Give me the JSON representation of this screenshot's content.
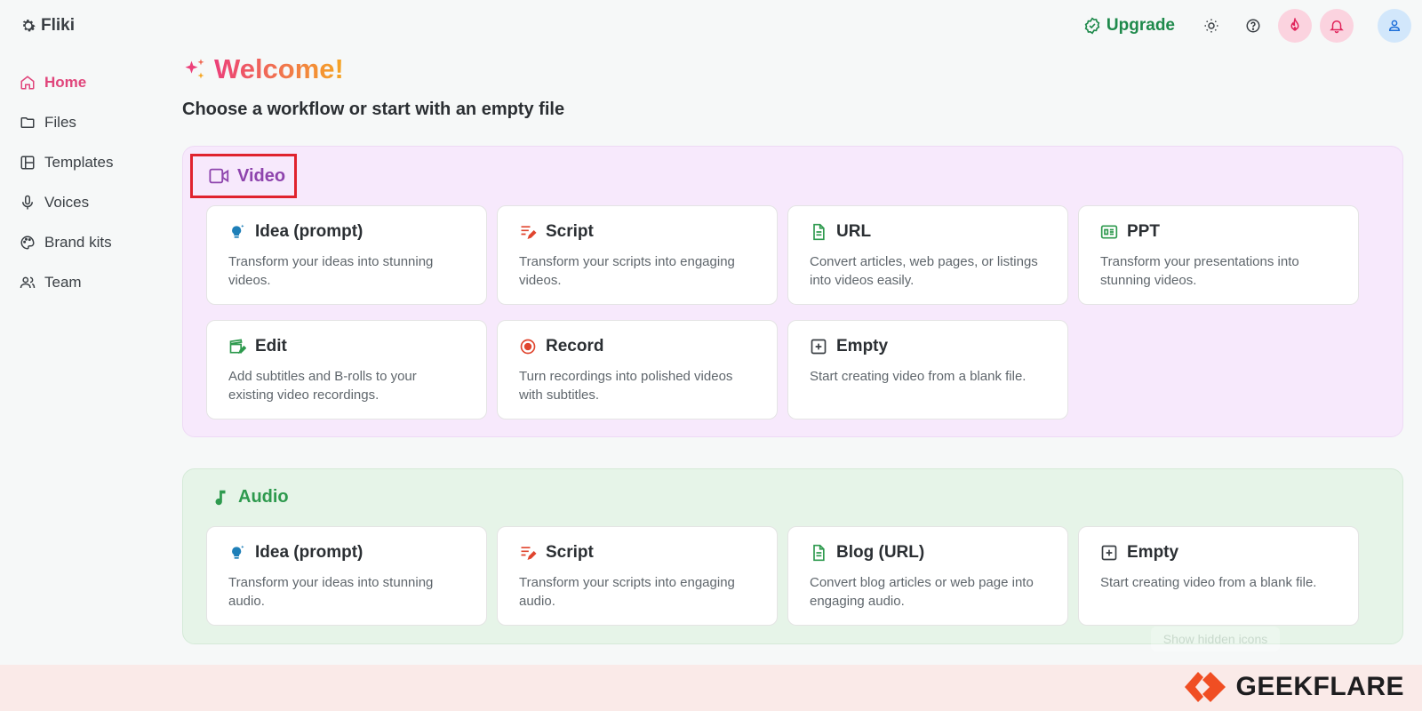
{
  "app": {
    "name": "Fliki"
  },
  "sidebar": {
    "items": [
      {
        "label": "Home",
        "icon": "home-icon",
        "active": true
      },
      {
        "label": "Files",
        "icon": "folder-icon"
      },
      {
        "label": "Templates",
        "icon": "templates-icon"
      },
      {
        "label": "Voices",
        "icon": "microphone-icon"
      },
      {
        "label": "Brand kits",
        "icon": "palette-icon"
      },
      {
        "label": "Team",
        "icon": "team-icon"
      }
    ]
  },
  "topbar": {
    "upgrade_label": "Upgrade",
    "icons": [
      "sun-icon",
      "help-icon",
      "fire-icon",
      "bell-icon",
      "user-icon"
    ]
  },
  "main": {
    "welcome": "Welcome!",
    "subtitle": "Choose a workflow or start with an empty file"
  },
  "video": {
    "title": "Video",
    "cards": [
      {
        "title": "Idea (prompt)",
        "desc": "Transform your ideas into stunning videos."
      },
      {
        "title": "Script",
        "desc": "Transform your scripts into engaging videos."
      },
      {
        "title": "URL",
        "desc": "Convert articles, web pages, or listings into videos easily."
      },
      {
        "title": "PPT",
        "desc": "Transform your presentations into stunning videos."
      },
      {
        "title": "Edit",
        "desc": "Add subtitles and B-rolls to your existing video recordings."
      },
      {
        "title": "Record",
        "desc": "Turn recordings into polished videos with subtitles."
      },
      {
        "title": "Empty",
        "desc": "Start creating video from a blank file."
      }
    ]
  },
  "audio": {
    "title": "Audio",
    "cards": [
      {
        "title": "Idea (prompt)",
        "desc": "Transform your ideas into stunning audio."
      },
      {
        "title": "Script",
        "desc": "Transform your scripts into engaging audio."
      },
      {
        "title": "Blog (URL)",
        "desc": "Convert blog articles or web page into engaging audio."
      },
      {
        "title": "Empty",
        "desc": "Start creating video from a blank file."
      }
    ]
  },
  "hint": "Show hidden icons",
  "watermark": "GEEKFLARE",
  "colors": {
    "accent": "#e0457b",
    "video": "#8e44ad",
    "audio": "#2e9a4e",
    "upgrade": "#1f8a4c"
  }
}
